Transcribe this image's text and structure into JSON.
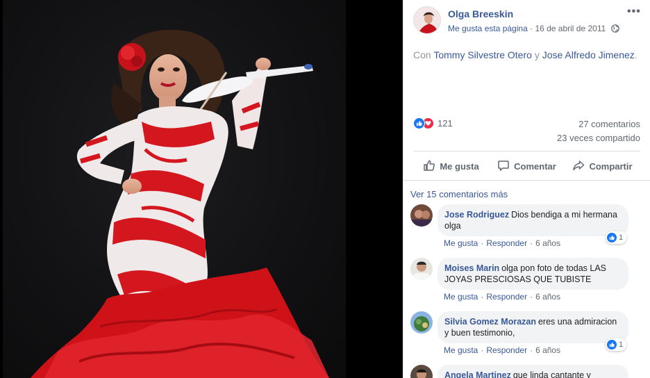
{
  "post": {
    "page_name": "Olga Breeskin",
    "like_page": "Me gusta esta página",
    "separator": "·",
    "date": "16 de abril de 2011",
    "more": "•••",
    "with_prefix": "Con",
    "tag_1": "Tommy Silvestre Otero",
    "and": "y",
    "tag_2": "Jose Alfredo Jimenez",
    "end": "."
  },
  "stats": {
    "reaction_count": "121",
    "comments": "27 comentarios",
    "shares": "23 veces compartido"
  },
  "actions": {
    "like": "Me gusta",
    "comment": "Comentar",
    "share": "Compartir"
  },
  "view_more": "Ver 15 comentarios más",
  "comment_actions": {
    "like": "Me gusta",
    "reply": "Responder",
    "dot": "·"
  },
  "comments": [
    {
      "author": "Jose Rodriguez",
      "text": "Dios bendiga a mi hermana olga",
      "time": "6 años",
      "reactions": "1"
    },
    {
      "author": "Moises Marin",
      "text": "olga pon foto de todas LAS JOYAS PRESCIOSAS QUE TUBISTE",
      "time": "6 años"
    },
    {
      "author": "Silvia Gomez Morazan",
      "text": "eres una admiracion y buen testimonio,",
      "time": "6 años",
      "reactions": "1"
    },
    {
      "author": "Angela Martinez",
      "text": "que linda cantante y"
    }
  ],
  "colors": {
    "link": "#385898",
    "secondary_text": "#606770",
    "muted_text": "#90949c",
    "bubble": "#f2f3f5",
    "like_blue": "#1877f2",
    "love_red": "#f0284a",
    "dress_red": "#d4171f"
  },
  "icons": [
    "globe-icon",
    "like-icon",
    "love-icon",
    "thumbs-up-icon",
    "comment-bubble-icon",
    "share-arrow-icon",
    "more-dots-icon"
  ]
}
